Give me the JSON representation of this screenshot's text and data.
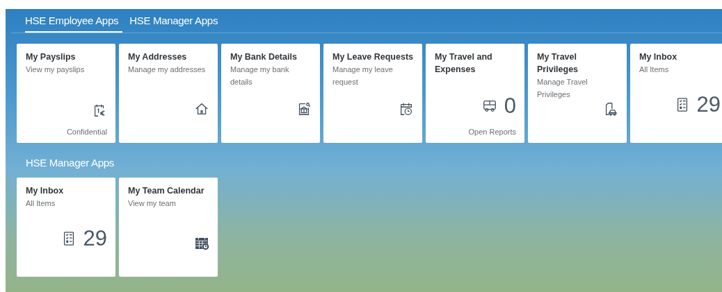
{
  "tabs": [
    {
      "label": "HSE Employee Apps",
      "selected": true
    },
    {
      "label": "HSE Manager Apps",
      "selected": false
    }
  ],
  "groups": [
    {
      "tiles": [
        {
          "kind": "payslips",
          "title": "My Payslips",
          "subtitle": "View my payslips",
          "footer": "Confidential"
        },
        {
          "kind": "addresses",
          "title": "My Addresses",
          "subtitle": "Manage my addresses"
        },
        {
          "kind": "bank",
          "title": "My Bank Details",
          "subtitle": "Manage my bank details"
        },
        {
          "kind": "leave",
          "title": "My Leave Requests",
          "subtitle": "Manage my leave request"
        },
        {
          "kind": "expenses",
          "title": "My Travel and Expenses",
          "number": "0",
          "footer": "Open Reports"
        },
        {
          "kind": "privileges",
          "title": "My Travel Privileges",
          "subtitle": "Manage Travel Privileges"
        },
        {
          "kind": "inbox",
          "title": "My Inbox",
          "subtitle": "All Items",
          "number": "29"
        }
      ]
    },
    {
      "title": "HSE Manager Apps",
      "tiles": [
        {
          "kind": "inbox",
          "title": "My Inbox",
          "subtitle": "All Items",
          "number": "29"
        },
        {
          "kind": "calendar",
          "title": "My Team Calendar",
          "subtitle": "View my team"
        }
      ]
    }
  ]
}
